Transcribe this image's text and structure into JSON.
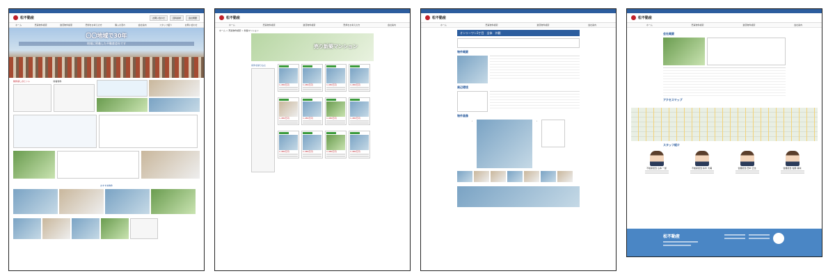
{
  "site": {
    "logo_text": "松不動産",
    "header_buttons": [
      "お問い合わせ",
      "資料請求",
      "会社概要"
    ],
    "nav": [
      "ホーム",
      "売買物件検索",
      "賃貸物件検索",
      "売却をお考えの方",
      "購入の流れ",
      "会社案内",
      "スタッフ紹介",
      "お問い合わせ"
    ]
  },
  "page1": {
    "hero_title": "〇〇地域で30年",
    "hero_sub": "地域に密着した不動産会社です",
    "section1": "物件探しのヒント",
    "section2": "新着物件",
    "bottom_label": "おすすめ物件"
  },
  "page2": {
    "breadcrumb": "ホーム > 売買物件検索 > 新築マンション",
    "banner_title": "売り新築マンション",
    "side_title": "条件を絞り込む",
    "price": "1,480万円"
  },
  "page3": {
    "title_bar": "オンリーワン3丁目　全体　外観",
    "section1": "物件概要",
    "section2": "周辺環境",
    "section3": "物件画像"
  },
  "page4": {
    "section1": "会社概要",
    "section2": "アクセスマップ",
    "section3": "スタッフ紹介",
    "staff": [
      "不動産担当 山本 一郎",
      "不動産担当 鈴木 大輔",
      "営業担当 田中 正也",
      "営業担当 佐藤 美咲"
    ],
    "footer_logo": "松不動産"
  }
}
